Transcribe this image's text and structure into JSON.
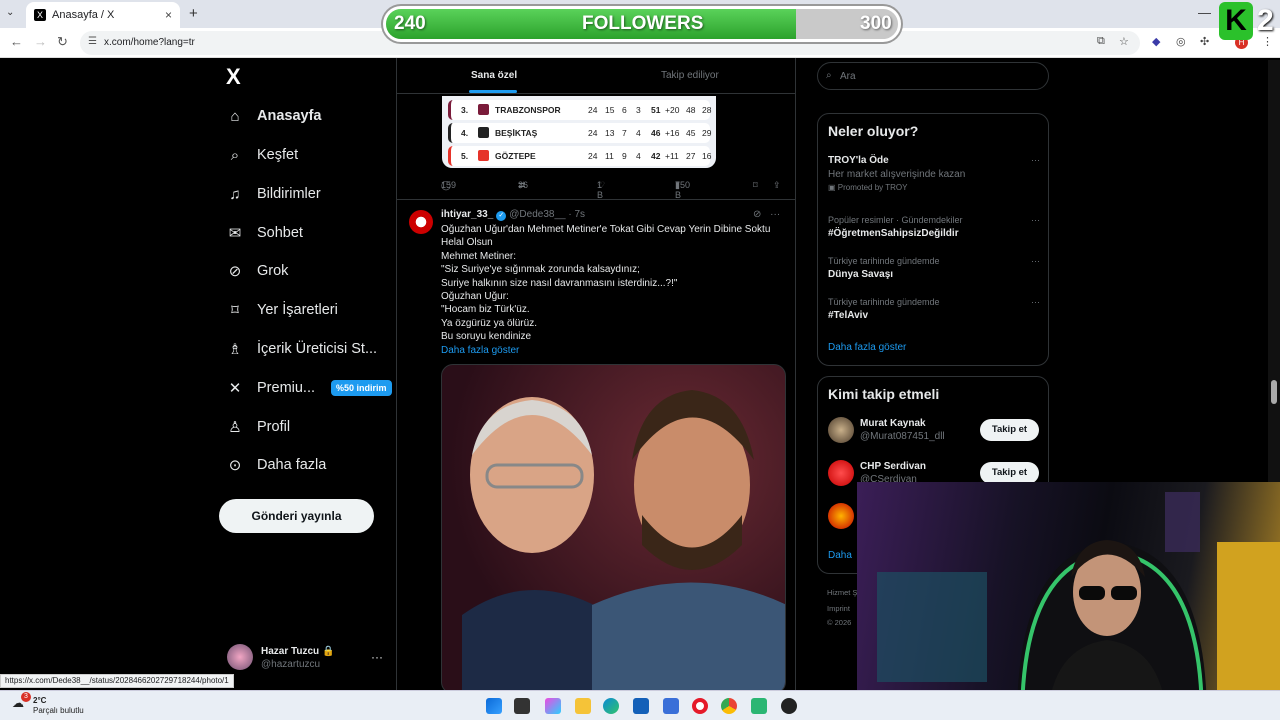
{
  "browser": {
    "tab_title": "Anasayfa / X",
    "url": "x.com/home?lang=tr",
    "status_url": "https://x.com/Dede38__/status/2028466202729718244/photo/1"
  },
  "overlay": {
    "followers_current": "240",
    "followers_label": "FOLLOWERS",
    "followers_goal": "300",
    "followers_progress": 0.8,
    "k_letter": "K",
    "k_number": "2"
  },
  "nav": {
    "logo": "X",
    "items": [
      {
        "label": "Anasayfa",
        "icon": "home-icon"
      },
      {
        "label": "Keşfet",
        "icon": "search-icon"
      },
      {
        "label": "Bildirimler",
        "icon": "bell-icon"
      },
      {
        "label": "Sohbet",
        "icon": "mail-icon"
      },
      {
        "label": "Grok",
        "icon": "grok-icon"
      },
      {
        "label": "Yer İşaretleri",
        "icon": "bookmark-icon"
      },
      {
        "label": "İçerik Üreticisi St...",
        "icon": "creator-icon"
      },
      {
        "label": "Premiu...",
        "icon": "x-icon",
        "badge": "%50 indirim"
      },
      {
        "label": "Profil",
        "icon": "person-icon"
      },
      {
        "label": "Daha fazla",
        "icon": "more-icon"
      }
    ],
    "post_button": "Gönderi yayınla",
    "account": {
      "name": "Hazar Tuzcu",
      "handle": "@hazartuzcu"
    }
  },
  "feed": {
    "tabs": [
      "Sana özel",
      "Takip ediliyor"
    ],
    "standings": [
      {
        "pos": "3.",
        "team": "TRABZONSPOR",
        "cols": [
          "24",
          "15",
          "6",
          "3",
          "51",
          "+20",
          "48",
          "28"
        ],
        "color": "#7a1b3a"
      },
      {
        "pos": "4.",
        "team": "BEŞİKTAŞ",
        "cols": [
          "24",
          "13",
          "7",
          "4",
          "46",
          "+16",
          "45",
          "29"
        ],
        "color": "#222222"
      },
      {
        "pos": "5.",
        "team": "GÖZTEPE",
        "cols": [
          "24",
          "11",
          "9",
          "4",
          "42",
          "+11",
          "27",
          "16"
        ],
        "color": "#e6332a"
      }
    ],
    "prev_actions": {
      "replies": "159",
      "reposts": "36",
      "likes": "1 B",
      "views": "750 B"
    },
    "tweet": {
      "name": "ihtiyar_33_",
      "handle": "@Dede38__",
      "time": "· 7s",
      "lines": [
        "Oğuzhan Uğur'dan Mehmet Metiner'e Tokat Gibi Cevap Yerin Dibine Soktu",
        "Helal Olsun",
        "Mehmet Metiner:",
        "\"Siz Suriye'ye sığınmak zorunda kalsaydınız;",
        "Suriye halkının size nasıl davranmasını isterdiniz...?!\"",
        "Oğuzhan Uğur:",
        "\"Hocam biz Türk'üz.",
        "Ya özgürüz ya ölürüz.",
        "Bu soruyu kendinize"
      ],
      "show_more": "Daha fazla göster"
    }
  },
  "right": {
    "search_placeholder": "Ara",
    "trends_title": "Neler oluyor?",
    "trends": [
      {
        "title": "TROY'la Öde",
        "sub": "Her market alışverişinde kazan",
        "meta": "Promoted by TROY"
      },
      {
        "context": "Popüler resimler · Gündemdekiler",
        "title": "#ÖğretmenSahipsizDeğildir"
      },
      {
        "context": "Türkiye tarihinde gündemde",
        "title": "Dünya Savaşı"
      },
      {
        "context": "Türkiye tarihinde gündemde",
        "title": "#TelAviv"
      }
    ],
    "trends_more": "Daha fazla göster",
    "who_title": "Kimi takip etmeli",
    "who": [
      {
        "name": "Murat Kaynak",
        "handle": "@Murat087451_dll",
        "button": "Takip et"
      },
      {
        "name": "CHP Serdivan",
        "handle": "@CSerdivan",
        "button": "Takip et"
      }
    ],
    "who_more": "Daha",
    "footer": [
      "Hizmet Ş",
      "Imprint",
      "© 2026"
    ]
  },
  "taskbar": {
    "temperature": "2°C",
    "condition": "Parçalı bulutlu",
    "notification_count": "3"
  }
}
